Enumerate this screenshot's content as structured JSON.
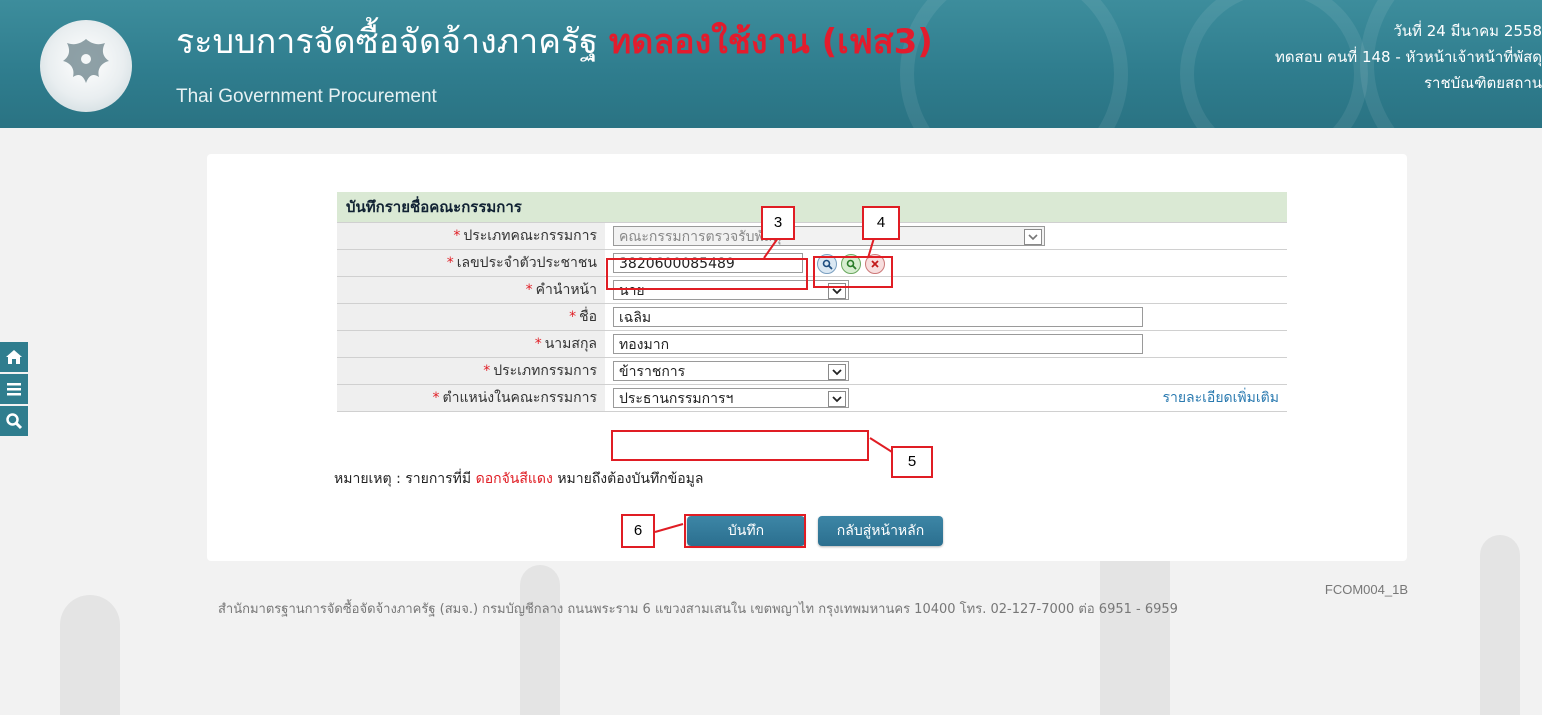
{
  "header": {
    "title": "ระบบการจัดซื้อจัดจ้างภาครัฐ",
    "trial_label": "ทดลองใช้งาน (เฟส3)",
    "subtitle": "Thai Government Procurement",
    "date": "วันที่ 24 มีนาคม 2558",
    "user_line": "ทดสอบ คนที่ 148 - หัวหน้าเจ้าหน้าที่พัสดุ",
    "org": "ราชบัณฑิตยสถาน"
  },
  "sidenav": {
    "items": [
      "home-icon",
      "menu-icon",
      "search-icon"
    ]
  },
  "form": {
    "section_title": "บันทึกรายชื่อคณะกรรมการ",
    "fields": {
      "committee_type": {
        "label": "ประเภทคณะกรรมการ",
        "value": "คณะกรรมการตรวจรับพัสดุ"
      },
      "citizen_id": {
        "label": "เลขประจำตัวประชาชน",
        "value": "3820600085489"
      },
      "prefix": {
        "label": "คำนำหน้า",
        "value": "นาย"
      },
      "first_name": {
        "label": "ชื่อ",
        "value": "เฉลิม"
      },
      "last_name": {
        "label": "นามสกุล",
        "value": "ทองมาก"
      },
      "member_type": {
        "label": "ประเภทกรรมการ",
        "value": "ข้าราชการ"
      },
      "position": {
        "label": "ตำแหน่งในคณะกรรมการ",
        "value": "ประธานกรรมการฯ"
      }
    },
    "more_link": "รายละเอียดเพิ่มเติม",
    "required_mark": "*",
    "note_prefix": "หมายเหตุ : รายการที่มี",
    "note_red": "ดอกจันสีแดง",
    "note_suffix": "หมายถึงต้องบันทึกข้อมูล",
    "save_button": "บันทึก",
    "back_button": "กลับสู่หน้าหลัก"
  },
  "screen_code": "FCOM004_1B",
  "footer": "สำนักมาตรฐานการจัดซื้อจัดจ้างภาครัฐ (สมจ.) กรมบัญชีกลาง ถนนพระราม 6 แขวงสามเสนใน เขตพญาไท กรุงเทพมหานคร 10400 โทร. 02-127-7000 ต่อ 6951 - 6959",
  "callouts": {
    "c3": "3",
    "c4": "4",
    "c5": "5",
    "c6": "6"
  },
  "colors": {
    "header": "#2f7d8e",
    "required": "#e01d24",
    "section_bg": "#dae9d4",
    "link": "#2a7ab0"
  }
}
